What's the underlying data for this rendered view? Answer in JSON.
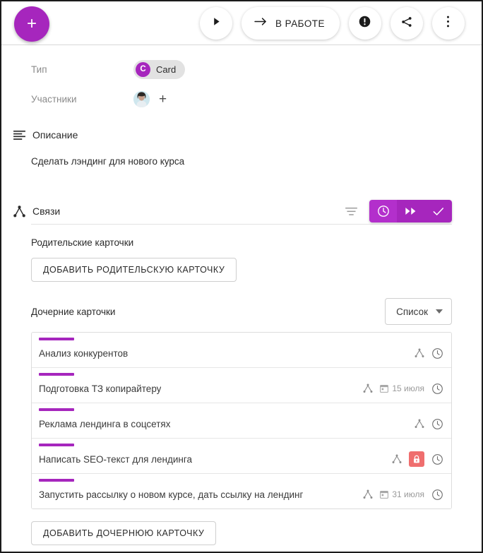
{
  "toolbar": {
    "add_button_label": "+",
    "add_button_name": "plus-icon",
    "play_button_name": "play-icon",
    "status_button_label": "В РАБОТЕ",
    "status_arrow_name": "arrow-right-icon",
    "alert_button_name": "exclamation-circle-icon",
    "share_button_name": "share-icon",
    "more_button_name": "more-vertical-icon",
    "accent_color": "#a626bd"
  },
  "fields": {
    "type": {
      "label": "Тип",
      "chip_initial": "C",
      "chip_text": "Card"
    },
    "members": {
      "label": "Участники",
      "add_label": "+"
    }
  },
  "description": {
    "section_title": "Описание",
    "section_icon": "text-lines-icon",
    "text": "Сделать лэндинг для нового курса"
  },
  "links": {
    "section_title": "Связи",
    "section_icon": "hierarchy-icon",
    "filter_icon": "filter-icon",
    "segments": [
      {
        "name": "clock-icon",
        "active": true
      },
      {
        "name": "fast-forward-icon",
        "active": false
      },
      {
        "name": "check-icon",
        "active": false
      }
    ],
    "parent_label": "Родительские карточки",
    "add_parent_button": "ДОБАВИТЬ РОДИТЕЛЬСКУЮ КАРТОЧКУ",
    "children_label": "Дочерние карточки",
    "view_select_value": "Список",
    "add_child_button": "ДОБАВИТЬ ДОЧЕРНЮЮ КАРТОЧКУ",
    "bar_color": "#a626bd",
    "lock_color": "#ef6e6e"
  },
  "child_cards": [
    {
      "title": "Анализ конкурентов",
      "has_hierarchy": true,
      "date": "",
      "locked": false,
      "has_clock": true
    },
    {
      "title": "Подготовка ТЗ копирайтеру",
      "has_hierarchy": true,
      "date": "15 июля",
      "locked": false,
      "has_clock": true
    },
    {
      "title": "Реклама лендинга в соцсетях",
      "has_hierarchy": true,
      "date": "",
      "locked": false,
      "has_clock": true
    },
    {
      "title": "Написать SEO-текст для лендинга",
      "has_hierarchy": true,
      "date": "",
      "locked": true,
      "has_clock": true
    },
    {
      "title": "Запустить рассылку о новом курсе, дать ссылку на лендинг",
      "has_hierarchy": true,
      "date": "31 июля",
      "locked": false,
      "has_clock": true
    }
  ]
}
